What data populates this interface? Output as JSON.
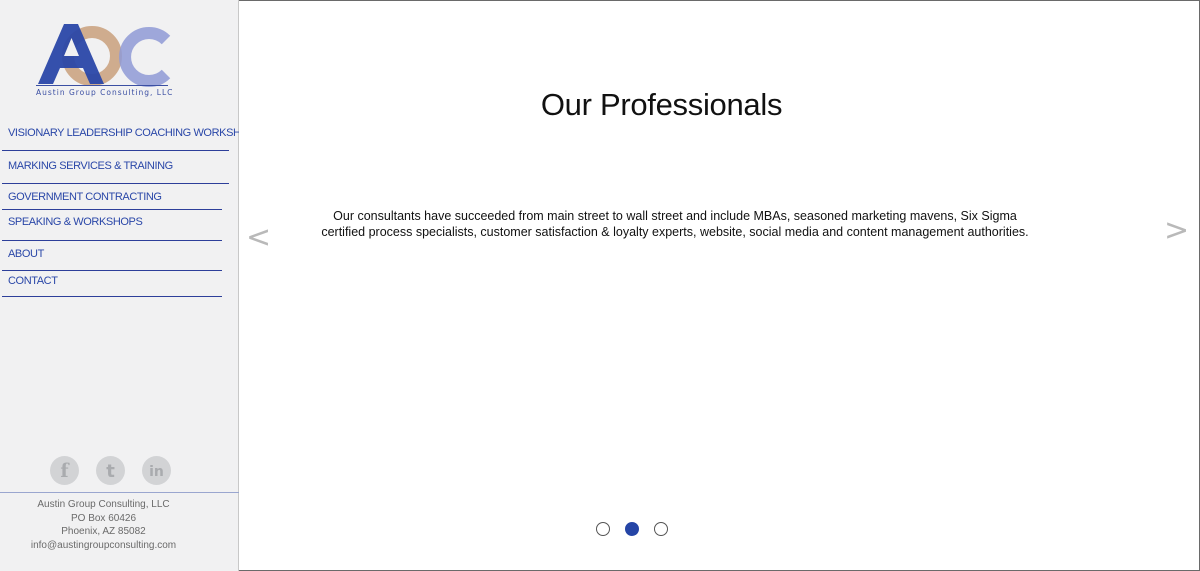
{
  "logo": {
    "caption": "Austin Group Consulting, LLC"
  },
  "nav": {
    "items": [
      {
        "label": "VISIONARY LEADERSHIP COACHING WORKSHOP"
      },
      {
        "label": "MARKING SERVICES & TRAINING"
      },
      {
        "label": "GOVERNMENT CONTRACTING"
      },
      {
        "label": "SPEAKING & WORKSHOPS"
      },
      {
        "label": "ABOUT"
      },
      {
        "label": "CONTACT"
      }
    ]
  },
  "social": [
    {
      "icon": "facebook-icon",
      "glyph": "f"
    },
    {
      "icon": "twitter-icon",
      "glyph": "t"
    },
    {
      "icon": "linkedin-icon",
      "glyph": "in"
    }
  ],
  "address": {
    "line1": "Austin Group Consulting, LLC",
    "line2": "PO Box 60426",
    "line3": "Phoenix, AZ 85082",
    "line4": "info@austingroupconsulting.com"
  },
  "slide": {
    "title": "Our Professionals",
    "text": "Our consultants have succeeded from main street to wall street and include MBAs, seasoned marketing mavens, Six Sigma certified process specialists, customer satisfaction & loyalty experts, website, social media and content management authorities.",
    "prev": "<",
    "next": ">",
    "total": 3,
    "active": 2
  },
  "colors": {
    "brand_blue": "#2a47a8",
    "brand_tan": "#c9a07c",
    "brand_lavender": "#8f9ad6"
  }
}
